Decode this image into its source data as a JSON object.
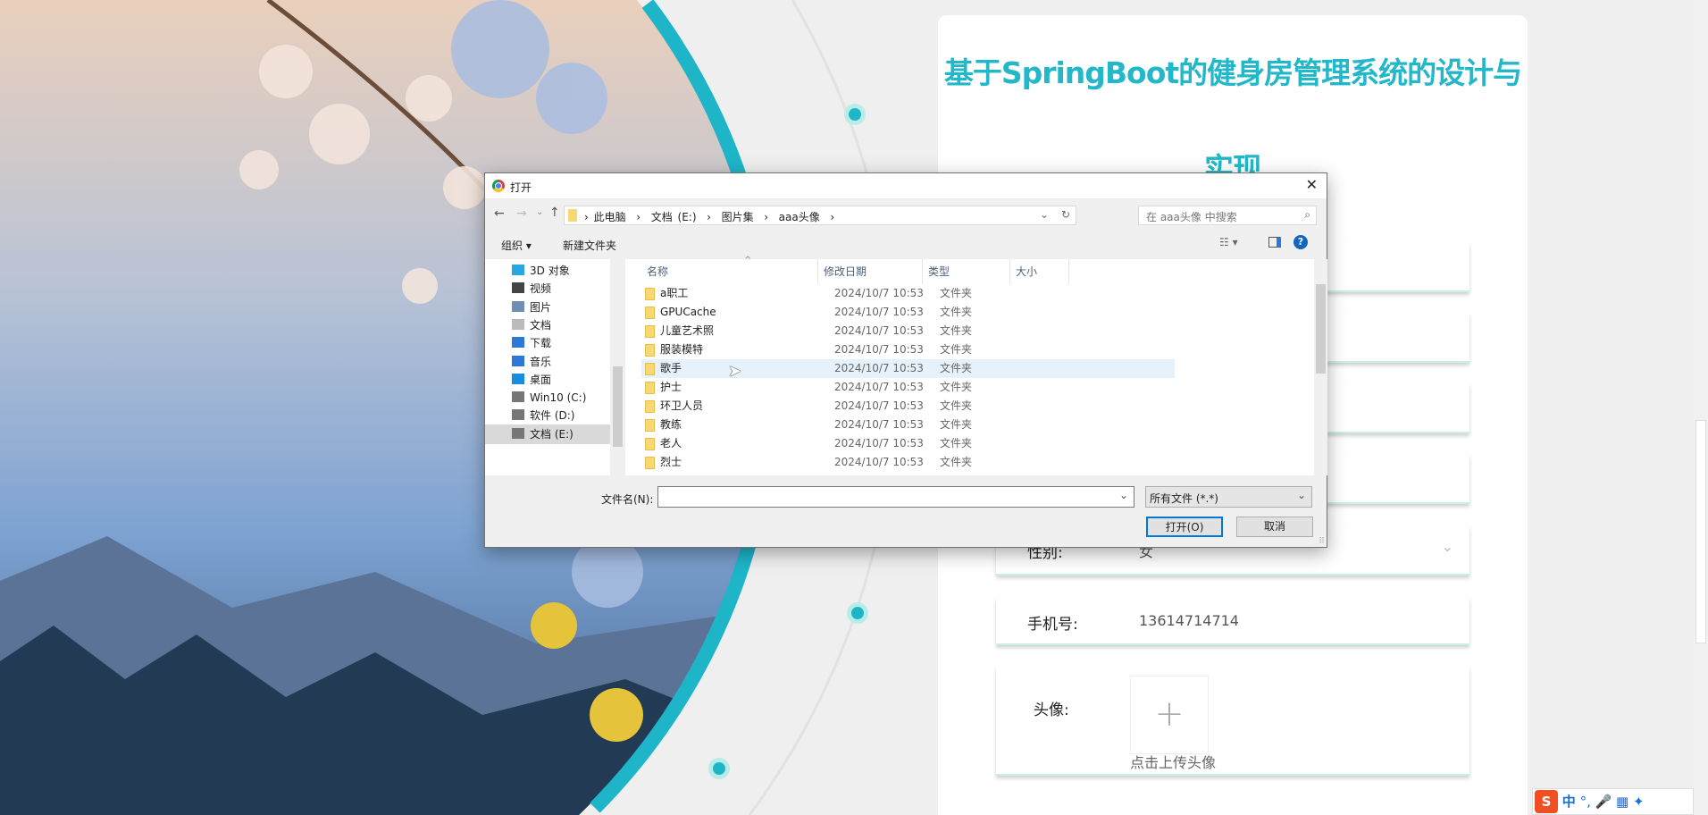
{
  "page": {
    "title_line1": "基于SpringBoot的健身房管理系统的设计与",
    "title_line2": "实现",
    "accent": "#22b8c9"
  },
  "form": {
    "gender": {
      "label": "性别:",
      "value": "女"
    },
    "phone": {
      "label": "手机号:",
      "value": "13614714714"
    },
    "avatar": {
      "label": "头像:",
      "plus": "+",
      "hint": "点击上传头像"
    }
  },
  "dialog": {
    "title": "打开",
    "breadcrumb": [
      "此电脑",
      "文档 (E:)",
      "图片集",
      "aaa头像"
    ],
    "search_placeholder": "在 aaa头像 中搜索",
    "organize": "组织 ▾",
    "new_folder": "新建文件夹",
    "nav": [
      {
        "label": "3D 对象",
        "icon": "cube-icon",
        "color": "#2aa7e0"
      },
      {
        "label": "视频",
        "icon": "film-icon",
        "color": "#444"
      },
      {
        "label": "图片",
        "icon": "picture-icon",
        "color": "#6d8fb5"
      },
      {
        "label": "文档",
        "icon": "document-icon",
        "color": "#bbb"
      },
      {
        "label": "下载",
        "icon": "download-icon",
        "color": "#2d7ad6"
      },
      {
        "label": "音乐",
        "icon": "music-icon",
        "color": "#2d7ad6"
      },
      {
        "label": "桌面",
        "icon": "desktop-icon",
        "color": "#1a8ce0"
      },
      {
        "label": "Win10 (C:)",
        "icon": "drive-icon",
        "color": "#777"
      },
      {
        "label": "软件 (D:)",
        "icon": "drive-icon",
        "color": "#777"
      },
      {
        "label": "文档 (E:)",
        "icon": "drive-icon",
        "color": "#777"
      }
    ],
    "columns": {
      "name": "名称",
      "date": "修改日期",
      "type": "类型",
      "size": "大小"
    },
    "files": [
      {
        "name": "a职工",
        "date": "2024/10/7 10:53",
        "type": "文件夹"
      },
      {
        "name": "GPUCache",
        "date": "2024/10/7 10:53",
        "type": "文件夹"
      },
      {
        "name": "儿童艺术照",
        "date": "2024/10/7 10:53",
        "type": "文件夹"
      },
      {
        "name": "服装模特",
        "date": "2024/10/7 10:53",
        "type": "文件夹"
      },
      {
        "name": "歌手",
        "date": "2024/10/7 10:53",
        "type": "文件夹",
        "hovered": true
      },
      {
        "name": "护士",
        "date": "2024/10/7 10:53",
        "type": "文件夹"
      },
      {
        "name": "环卫人员",
        "date": "2024/10/7 10:53",
        "type": "文件夹"
      },
      {
        "name": "教练",
        "date": "2024/10/7 10:53",
        "type": "文件夹"
      },
      {
        "name": "老人",
        "date": "2024/10/7 10:53",
        "type": "文件夹"
      },
      {
        "name": "烈士",
        "date": "2024/10/7 10:53",
        "type": "文件夹"
      }
    ],
    "filename_label": "文件名(N):",
    "filename_value": "",
    "filter": "所有文件 (*.*)",
    "open": "打开(O)",
    "cancel": "取消"
  },
  "ime": {
    "lang": "中"
  }
}
